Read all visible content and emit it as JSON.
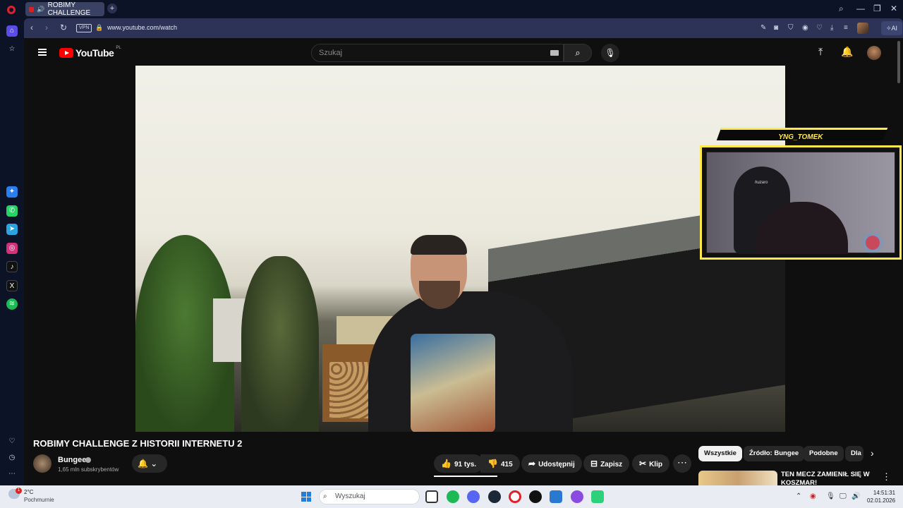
{
  "browser": {
    "tab_title": "ROBIMY CHALLENGE",
    "new_tab": "+",
    "vpn": "VPN",
    "url": "www.youtube.com/watch",
    "ai_label": "AI"
  },
  "youtube": {
    "logo_text": "YouTube",
    "region": "PL",
    "search_placeholder": "Szukaj",
    "webcam_name": "YNG_TOMEK",
    "webcam_brand": "huzaro",
    "video_title": "ROBIMY CHALLENGE Z HISTORII INTERNETU 2",
    "channel": {
      "name": "Bungee",
      "subscribers": "1,65 mln subskrybentów"
    },
    "actions": {
      "likes": "91 tys.",
      "dislikes": "415",
      "share": "Udostępnij",
      "save": "Zapisz",
      "clip": "Klip"
    },
    "chips": [
      "Wszystkie",
      "Źródło: Bungee",
      "Podobne",
      "Dla"
    ],
    "recommendation": {
      "title": "TEN MECZ ZAMIENIŁ SIĘ W KOSZMAR!"
    }
  },
  "taskbar": {
    "temperature": "2°C",
    "condition": "Pochmurnie",
    "weather_badge": "1",
    "search": "Wyszukaj",
    "time": "14:51:31",
    "date": "02.01.2026"
  },
  "colors": {
    "webcam_frame": "#ffe94a",
    "youtube_red": "#ff0000",
    "opera_red": "#e0202e"
  }
}
